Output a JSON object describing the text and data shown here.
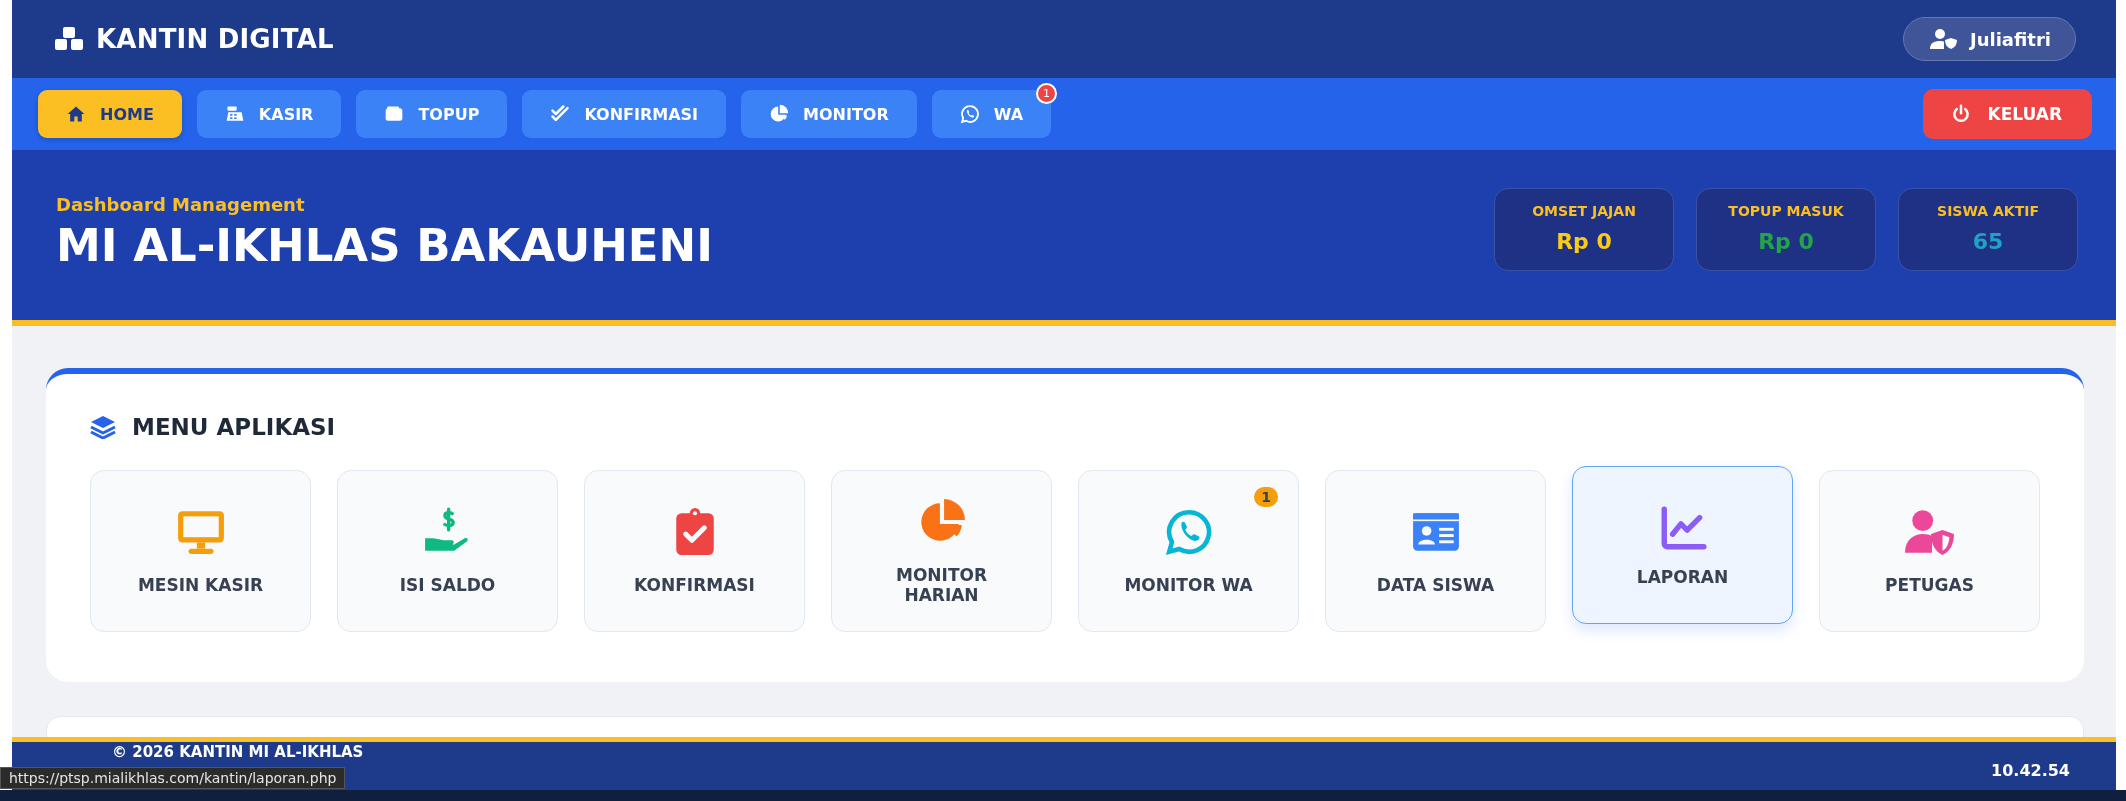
{
  "brand": {
    "title": "KANTIN DIGITAL"
  },
  "user": {
    "name": "Juliafitri"
  },
  "nav": [
    {
      "label": "HOME",
      "kind": "home",
      "selected": true
    },
    {
      "label": "KASIR",
      "kind": "register",
      "selected": false
    },
    {
      "label": "TOPUP",
      "kind": "wallet",
      "selected": false
    },
    {
      "label": "KONFIRMASI",
      "kind": "checks",
      "selected": false
    },
    {
      "label": "MONITOR",
      "kind": "pie",
      "selected": false
    },
    {
      "label": "WA",
      "kind": "whatsapp",
      "selected": false,
      "badge": "1"
    }
  ],
  "logout": {
    "label": "KELUAR"
  },
  "hero": {
    "subtitle": "Dashboard Management",
    "title": "MI AL-IKHLAS BAKAUHENI",
    "stats": [
      {
        "label": "OMSET JAJAN",
        "value": "Rp 0",
        "color": "#facc15"
      },
      {
        "label": "TOPUP MASUK",
        "value": "Rp 0",
        "color": "#22a547"
      },
      {
        "label": "SISWA AKTIF",
        "value": "65",
        "color": "#1fa3c4"
      }
    ]
  },
  "menu": {
    "title": "MENU APLIKASI",
    "items": [
      {
        "label": "MESIN KASIR",
        "kind": "monitor",
        "color": "#f59e0b",
        "selected": false
      },
      {
        "label": "ISI SALDO",
        "kind": "hand",
        "color": "#10b981",
        "selected": false
      },
      {
        "label": "KONFIRMASI",
        "kind": "clipboard",
        "color": "#ef4444",
        "selected": false
      },
      {
        "label": "MONITOR HARIAN",
        "kind": "pie",
        "color": "#f97316",
        "selected": false
      },
      {
        "label": "MONITOR WA",
        "kind": "whatsapp",
        "color": "#06b6d4",
        "selected": false,
        "badge": "1"
      },
      {
        "label": "DATA SISWA",
        "kind": "idcard",
        "color": "#3b82f6",
        "selected": false
      },
      {
        "label": "LAPORAN",
        "kind": "chart",
        "color": "#8b5cf6",
        "selected": true
      },
      {
        "label": "PETUGAS",
        "kind": "usershield",
        "color": "#ec4899",
        "selected": false
      }
    ]
  },
  "footer": {
    "copyright": "© 2026 KANTIN MI AL-IKHLAS",
    "time": "10.42.54"
  },
  "status_url": "https://ptsp.mialikhlas.com/kantin/laporan.php"
}
